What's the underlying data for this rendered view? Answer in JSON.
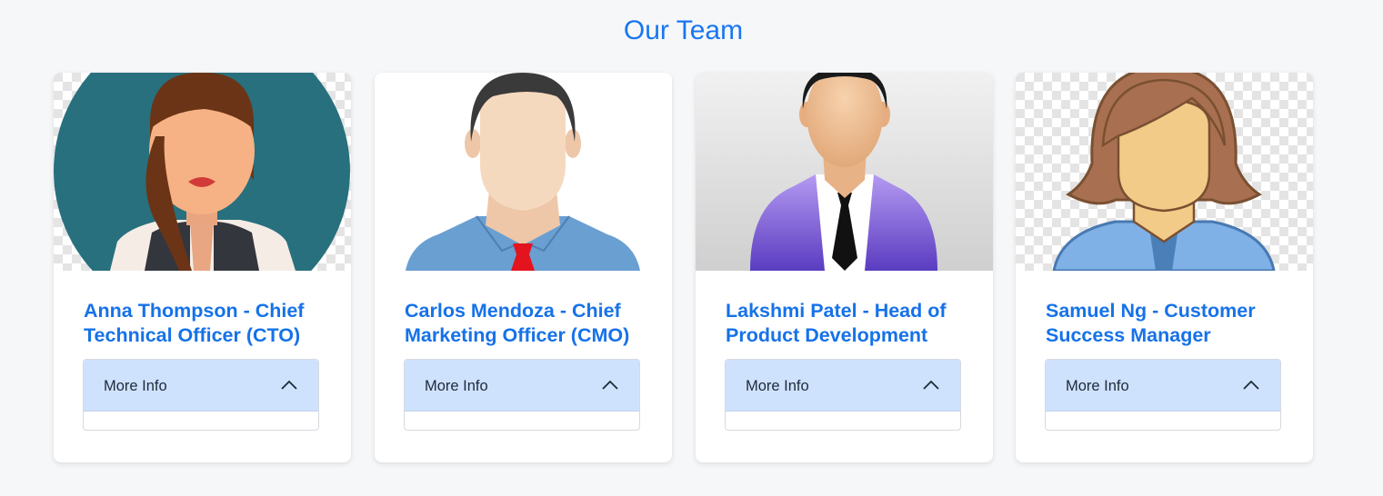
{
  "page": {
    "title": "Our Team"
  },
  "colors": {
    "accent": "#1877ef",
    "accordion_header": "#cfe2fd",
    "background": "#f6f7f9"
  },
  "team": [
    {
      "name": "Anna Thompson - Chief Technical Officer (CTO)",
      "avatar": "avatar-woman-teal-circle",
      "accordion_label": "More Info"
    },
    {
      "name": "Carlos Mendoza - Chief Marketing Officer (CMO)",
      "avatar": "avatar-man-blue-shirt-red-tie",
      "accordion_label": "More Info"
    },
    {
      "name": "Lakshmi Patel - Head of Product Development",
      "avatar": "avatar-man-purple-suit",
      "accordion_label": "More Info"
    },
    {
      "name": "Samuel Ng - Customer Success Manager",
      "avatar": "avatar-woman-brown-hair",
      "accordion_label": "More Info"
    }
  ]
}
